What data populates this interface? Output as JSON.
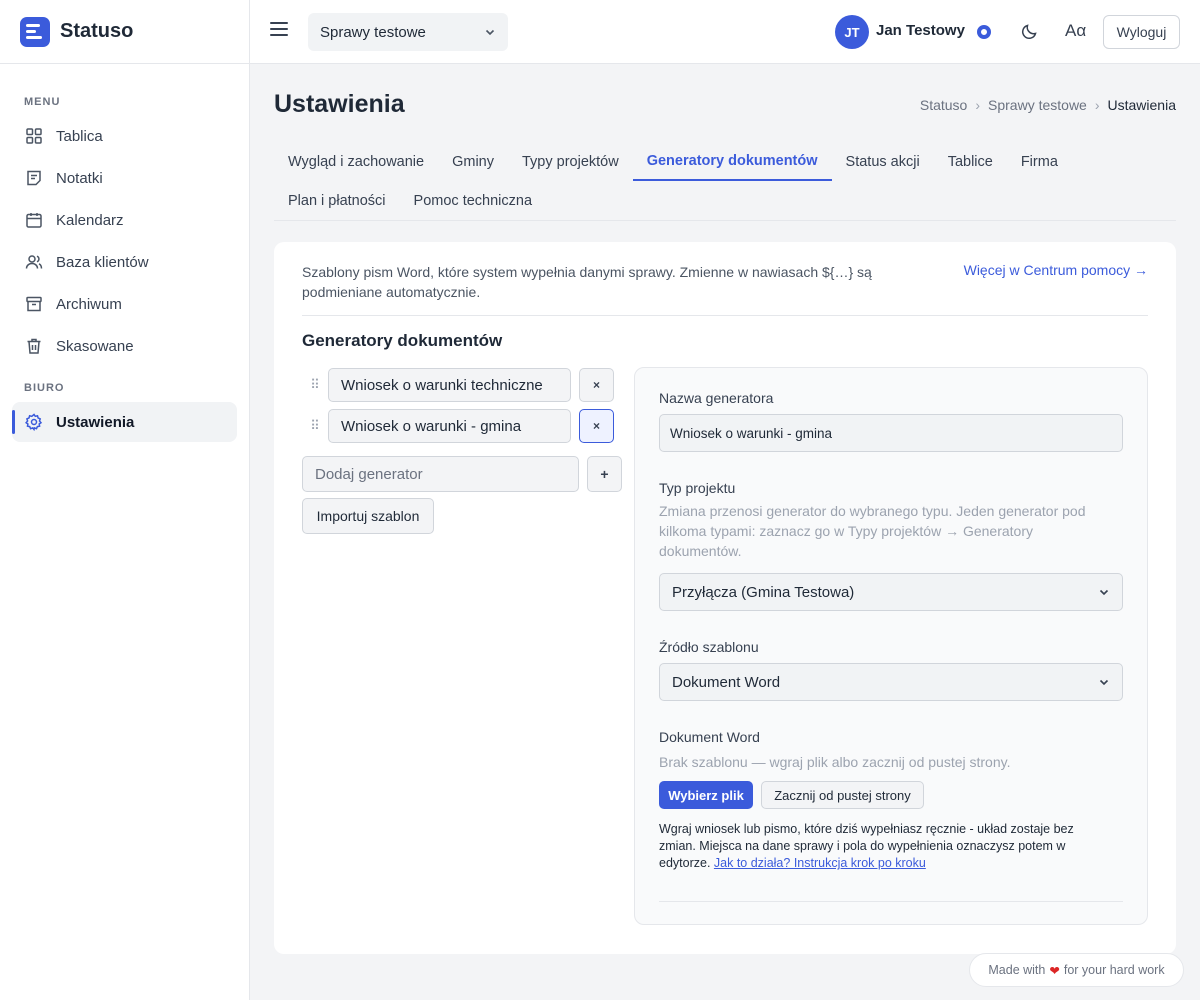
{
  "brand": {
    "name": "Statuso"
  },
  "sidebar": {
    "sections": [
      {
        "label": "MENU"
      },
      {
        "label": "BIURO"
      }
    ],
    "menu_items": [
      {
        "label": "Tablica",
        "icon": "grid-icon"
      },
      {
        "label": "Notatki",
        "icon": "note-icon"
      },
      {
        "label": "Kalendarz",
        "icon": "calendar-icon"
      },
      {
        "label": "Baza klientów",
        "icon": "users-icon"
      },
      {
        "label": "Archiwum",
        "icon": "archive-icon"
      },
      {
        "label": "Skasowane",
        "icon": "trash-icon"
      }
    ],
    "office_items": [
      {
        "label": "Ustawienia",
        "icon": "gear-icon",
        "active": true
      }
    ]
  },
  "topbar": {
    "case_select": "Sprawy testowe",
    "avatar_initials": "JT",
    "user_name": "Jan Testowy",
    "font_label": "Aα",
    "logout_label": "Wyloguj"
  },
  "page": {
    "title": "Ustawienia",
    "breadcrumb": [
      "Statuso",
      "Sprawy testowe",
      "Ustawienia"
    ]
  },
  "tabs": [
    {
      "label": "Wygląd i zachowanie",
      "active": false
    },
    {
      "label": "Gminy",
      "active": false
    },
    {
      "label": "Typy projektów",
      "active": false
    },
    {
      "label": "Generatory dokumentów",
      "active": true
    },
    {
      "label": "Status akcji",
      "active": false
    },
    {
      "label": "Tablice",
      "active": false
    },
    {
      "label": "Firma",
      "active": false
    },
    {
      "label": "Plan i płatności",
      "active": false
    },
    {
      "label": "Pomoc techniczna",
      "active": false
    }
  ],
  "content": {
    "intro": "Szablony pism Word, które system wypełnia danymi sprawy. Zmienne w nawiasach ${…} są podmieniane automatycznie.",
    "help_link": "Więcej w Centrum pomocy →",
    "section_title": "Generatory dokumentów",
    "generators": [
      {
        "name": "Wniosek o warunki techniczne",
        "remove": "×",
        "selected": false
      },
      {
        "name": "Wniosek o warunki - gmina",
        "remove": "×",
        "selected": true
      }
    ],
    "add_placeholder": "Dodaj generator",
    "add_button": "+",
    "import_button": "Importuj szablon"
  },
  "panel": {
    "name_label": "Nazwa generatora",
    "name_value": "Wniosek o warunki - gmina",
    "type_label": "Typ projektu",
    "type_help": "Zmiana przenosi generator do wybranego typu. Jeden generator pod kilkoma typami: zaznacz go w Typy projektów → Generatory dokumentów.",
    "type_value": "Przyłącza (Gmina Testowa)",
    "source_label": "Źródło szablonu",
    "source_value": "Dokument Word",
    "doc_label": "Dokument Word",
    "doc_help": "Brak szablonu — wgraj plik albo zacznij od pustej strony.",
    "choose_file": "Wybierz plik",
    "start_blank": "Zacznij od pustej strony",
    "note": "Wgraj wniosek lub pismo, które dziś wypełniasz ręcznie - układ zostaje bez zmian. Miejsca na dane sprawy i pola do wypełnienia oznaczysz potem w edytorze.",
    "note_link": "Jak to działa? Instrukcja krok po kroku"
  },
  "footer": {
    "made_prefix": "Made with",
    "made_suffix": "for your hard work"
  },
  "colors": {
    "accent": "#3b5bdb",
    "heart": "#dc2626"
  }
}
